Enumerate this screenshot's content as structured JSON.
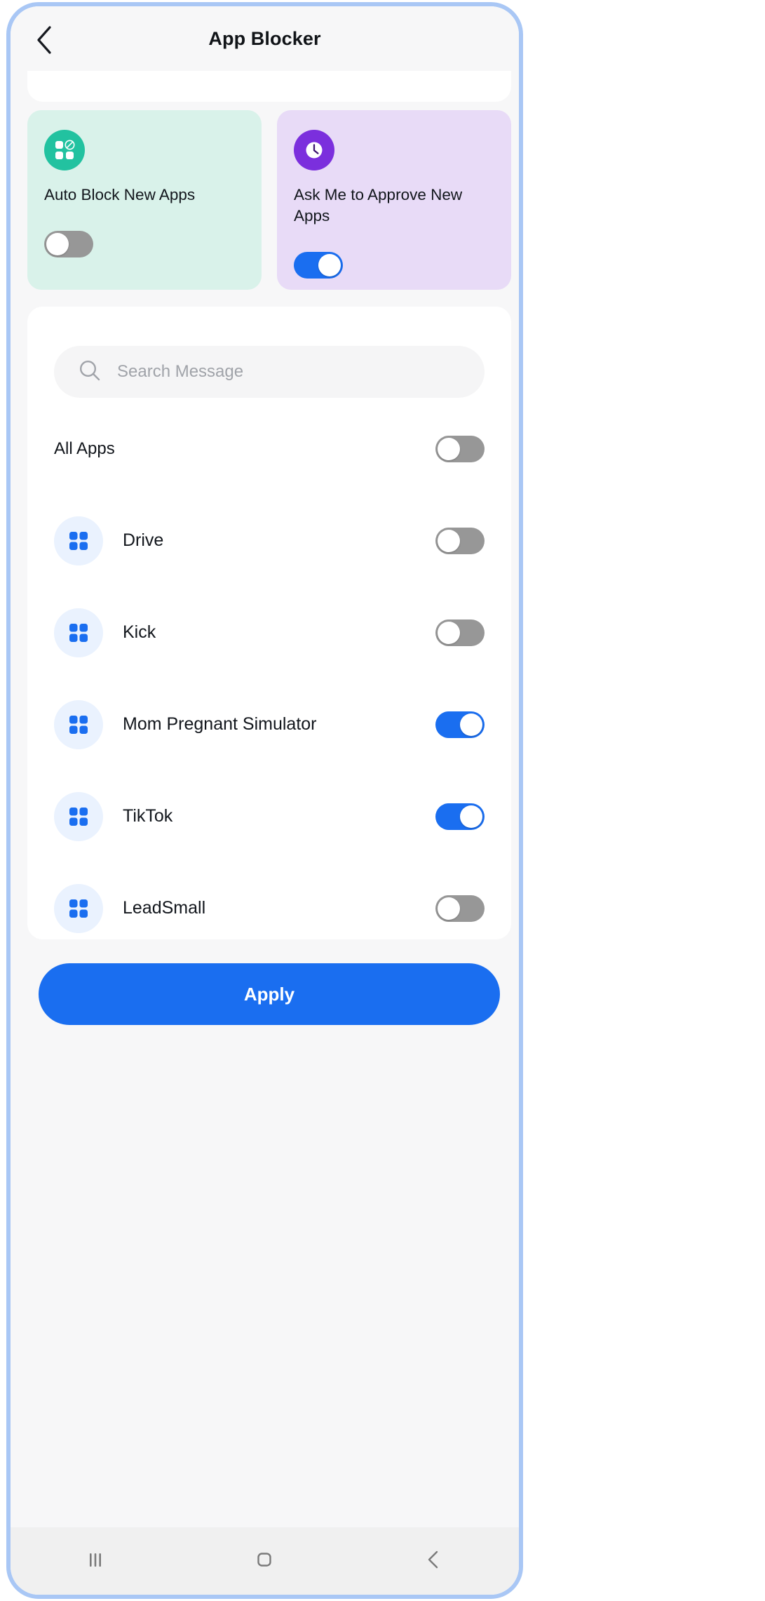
{
  "header": {
    "title": "App Blocker",
    "back_icon": "chevron-left-icon"
  },
  "feature_cards": [
    {
      "id": "auto-block-new-apps",
      "label": "Auto Block New Apps",
      "icon": "apps-grid-block-icon",
      "icon_bg": "#22c2a0",
      "card_bg": "#d9f2ea",
      "toggle_on": false
    },
    {
      "id": "ask-me-to-approve-new-apps",
      "label": "Ask Me to Approve New Apps",
      "icon": "clock-icon",
      "icon_bg": "#7b2fdd",
      "card_bg": "#e8dbf7",
      "toggle_on": true
    }
  ],
  "search": {
    "placeholder": "Search Message",
    "value": "",
    "icon": "search-icon"
  },
  "all_apps": {
    "label": "All Apps",
    "toggle_on": false
  },
  "apps": [
    {
      "name": "Drive",
      "icon": "apps-grid-icon",
      "toggle_on": false
    },
    {
      "name": "Kick",
      "icon": "apps-grid-icon",
      "toggle_on": false
    },
    {
      "name": "Mom Pregnant Simulator",
      "icon": "apps-grid-icon",
      "toggle_on": true
    },
    {
      "name": "TikTok",
      "icon": "apps-grid-icon",
      "toggle_on": true
    },
    {
      "name": "LeadSmall",
      "icon": "apps-grid-icon",
      "toggle_on": false
    }
  ],
  "apply": {
    "label": "Apply"
  },
  "navbar": {
    "items": [
      {
        "id": "recents",
        "icon": "recents-icon"
      },
      {
        "id": "home",
        "icon": "home-square-icon"
      },
      {
        "id": "back",
        "icon": "chevron-left-icon"
      }
    ]
  },
  "colors": {
    "accent_blue": "#1a6ef0",
    "toggle_off": "#979797",
    "frame": "#a9c7f5",
    "page_bg": "#f7f7f8"
  }
}
